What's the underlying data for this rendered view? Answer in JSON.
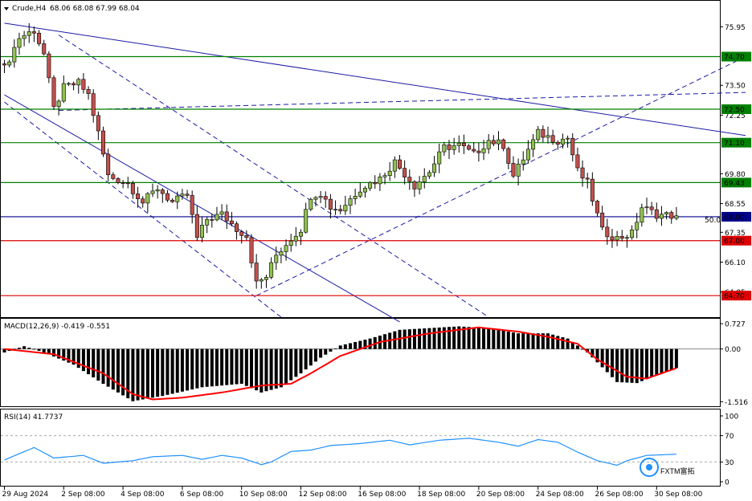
{
  "chart_data": [
    {
      "type": "candlestick",
      "header": {
        "symbol_timeframe": "Crude,H4",
        "ohlc": "68.06 68.08 67.99 68.04"
      },
      "ylim": [
        63.9,
        76.8
      ],
      "y_ticks": [
        "75.95",
        "73.50",
        "72.25",
        "69.80",
        "68.55",
        "67.35",
        "66.10",
        "64.85"
      ],
      "x_tick_labels": [
        "29 Aug 2024",
        "2 Sep 08:00",
        "4 Sep 08:00",
        "6 Sep 08:00",
        "10 Sep 08:00",
        "12 Sep 08:00",
        "16 Sep 08:00",
        "18 Sep 08:00",
        "20 Sep 08:00",
        "24 Sep 08:00",
        "26 Sep 08:00",
        "30 Sep 08:00"
      ],
      "x_tick_index": [
        0,
        12,
        24,
        36,
        48,
        60,
        72,
        84,
        96,
        108,
        120,
        132
      ],
      "candle_count": 137,
      "anchors": [
        {
          "i": 0,
          "p": 74.2
        },
        {
          "i": 3,
          "p": 75.5
        },
        {
          "i": 6,
          "p": 75.8
        },
        {
          "i": 8,
          "p": 74.8
        },
        {
          "i": 10,
          "p": 72.5
        },
        {
          "i": 12,
          "p": 73.4
        },
        {
          "i": 15,
          "p": 73.6
        },
        {
          "i": 17,
          "p": 73.1
        },
        {
          "i": 19,
          "p": 71.5
        },
        {
          "i": 21,
          "p": 69.7
        },
        {
          "i": 25,
          "p": 69.4
        },
        {
          "i": 28,
          "p": 68.6
        },
        {
          "i": 31,
          "p": 69.2
        },
        {
          "i": 34,
          "p": 68.6
        },
        {
          "i": 37,
          "p": 68.9
        },
        {
          "i": 39,
          "p": 67.1
        },
        {
          "i": 41,
          "p": 67.9
        },
        {
          "i": 44,
          "p": 68.1
        },
        {
          "i": 47,
          "p": 67.5
        },
        {
          "i": 49,
          "p": 67.2
        },
        {
          "i": 51,
          "p": 65.2
        },
        {
          "i": 53,
          "p": 65.5
        },
        {
          "i": 55,
          "p": 66.4
        },
        {
          "i": 58,
          "p": 67.1
        },
        {
          "i": 60,
          "p": 67.5
        },
        {
          "i": 62,
          "p": 68.9
        },
        {
          "i": 64,
          "p": 69.0
        },
        {
          "i": 66,
          "p": 68.4
        },
        {
          "i": 68,
          "p": 68.3
        },
        {
          "i": 72,
          "p": 69.2
        },
        {
          "i": 76,
          "p": 69.6
        },
        {
          "i": 79,
          "p": 70.3
        },
        {
          "i": 83,
          "p": 69.3
        },
        {
          "i": 86,
          "p": 69.9
        },
        {
          "i": 89,
          "p": 70.9
        },
        {
          "i": 92,
          "p": 71.0
        },
        {
          "i": 95,
          "p": 70.6
        },
        {
          "i": 98,
          "p": 71.2
        },
        {
          "i": 101,
          "p": 71.0
        },
        {
          "i": 103,
          "p": 69.7
        },
        {
          "i": 106,
          "p": 70.8
        },
        {
          "i": 108,
          "p": 71.5
        },
        {
          "i": 112,
          "p": 71.2
        },
        {
          "i": 114,
          "p": 71.3
        },
        {
          "i": 116,
          "p": 69.9
        },
        {
          "i": 118,
          "p": 69.4
        },
        {
          "i": 121,
          "p": 67.4
        },
        {
          "i": 124,
          "p": 67.1
        },
        {
          "i": 127,
          "p": 67.3
        },
        {
          "i": 129,
          "p": 68.4
        },
        {
          "i": 132,
          "p": 68.1
        },
        {
          "i": 136,
          "p": 68.04
        }
      ],
      "levels": [
        {
          "price": 74.7,
          "label": "74.70",
          "color": "#008000"
        },
        {
          "price": 72.5,
          "label": "72.50",
          "color": "#008000"
        },
        {
          "price": 71.1,
          "label": "71.10",
          "color": "#008000"
        },
        {
          "price": 69.43,
          "label": "69.43",
          "color": "#008000"
        },
        {
          "price": 68.0,
          "label": "68.00",
          "color": "#00008b"
        },
        {
          "price": 67.0,
          "label": "67.00",
          "color": "#dd0000"
        },
        {
          "price": 64.7,
          "label": "64.70",
          "color": "#dd0000"
        }
      ],
      "fib_label": "50.0",
      "trendlines": [
        {
          "i1": 0,
          "p1": 76.1,
          "i2": 150,
          "p2": 71.4,
          "style": "solid"
        },
        {
          "i1": 0,
          "p1": 73.1,
          "i2": 80,
          "p2": 63.6,
          "style": "solid"
        },
        {
          "i1": 11,
          "p1": 75.6,
          "i2": 98,
          "p2": 63.8,
          "style": "dashed"
        },
        {
          "i1": 0,
          "p1": 72.8,
          "i2": 56,
          "p2": 63.8,
          "style": "dashed"
        },
        {
          "i1": 11,
          "p1": 72.45,
          "i2": 150,
          "p2": 73.2,
          "style": "dashed"
        },
        {
          "i1": 51,
          "p1": 64.7,
          "i2": 150,
          "p2": 74.7,
          "style": "dashed"
        }
      ],
      "colors": {
        "bull": "#90c050",
        "bear": "#c0504d",
        "line": "#1a1aa6"
      }
    },
    {
      "type": "histogram",
      "title": "MACD(12,26,9) -0.419 -0.551",
      "ylim": [
        -1.6,
        0.8
      ],
      "y_ticks": [
        "0.727",
        "0.00",
        "-1.516"
      ],
      "macd_anchors": [
        {
          "i": 0,
          "v": -0.1
        },
        {
          "i": 4,
          "v": 0.08
        },
        {
          "i": 8,
          "v": -0.1
        },
        {
          "i": 14,
          "v": -0.45
        },
        {
          "i": 20,
          "v": -1.0
        },
        {
          "i": 26,
          "v": -1.5
        },
        {
          "i": 32,
          "v": -1.35
        },
        {
          "i": 40,
          "v": -1.1
        },
        {
          "i": 48,
          "v": -1.0
        },
        {
          "i": 52,
          "v": -1.25
        },
        {
          "i": 56,
          "v": -1.1
        },
        {
          "i": 60,
          "v": -0.7
        },
        {
          "i": 64,
          "v": -0.25
        },
        {
          "i": 68,
          "v": 0.1
        },
        {
          "i": 74,
          "v": 0.3
        },
        {
          "i": 80,
          "v": 0.55
        },
        {
          "i": 86,
          "v": 0.6
        },
        {
          "i": 92,
          "v": 0.65
        },
        {
          "i": 98,
          "v": 0.6
        },
        {
          "i": 104,
          "v": 0.45
        },
        {
          "i": 110,
          "v": 0.45
        },
        {
          "i": 114,
          "v": 0.3
        },
        {
          "i": 118,
          "v": -0.1
        },
        {
          "i": 124,
          "v": -0.95
        },
        {
          "i": 128,
          "v": -0.98
        },
        {
          "i": 132,
          "v": -0.75
        },
        {
          "i": 136,
          "v": -0.55
        }
      ],
      "signal_anchors": [
        {
          "i": 0,
          "v": 0.0
        },
        {
          "i": 10,
          "v": -0.15
        },
        {
          "i": 20,
          "v": -0.7
        },
        {
          "i": 26,
          "v": -1.3
        },
        {
          "i": 30,
          "v": -1.45
        },
        {
          "i": 36,
          "v": -1.4
        },
        {
          "i": 44,
          "v": -1.25
        },
        {
          "i": 52,
          "v": -1.05
        },
        {
          "i": 58,
          "v": -1.0
        },
        {
          "i": 62,
          "v": -0.7
        },
        {
          "i": 68,
          "v": -0.2
        },
        {
          "i": 76,
          "v": 0.2
        },
        {
          "i": 86,
          "v": 0.45
        },
        {
          "i": 96,
          "v": 0.62
        },
        {
          "i": 104,
          "v": 0.5
        },
        {
          "i": 110,
          "v": 0.35
        },
        {
          "i": 116,
          "v": 0.15
        },
        {
          "i": 120,
          "v": -0.3
        },
        {
          "i": 126,
          "v": -0.8
        },
        {
          "i": 130,
          "v": -0.85
        },
        {
          "i": 136,
          "v": -0.55
        }
      ],
      "colors": {
        "bar": "#000000",
        "signal": "#ff0000"
      }
    },
    {
      "type": "line",
      "title": "RSI(14) 41.7737",
      "ylim": [
        0,
        100
      ],
      "y_ticks": [
        "100",
        "70",
        "30",
        "0"
      ],
      "reference_lines": [
        70,
        30
      ],
      "rsi_anchors": [
        {
          "i": 0,
          "v": 33
        },
        {
          "i": 6,
          "v": 52
        },
        {
          "i": 10,
          "v": 36
        },
        {
          "i": 16,
          "v": 40
        },
        {
          "i": 20,
          "v": 28
        },
        {
          "i": 26,
          "v": 32
        },
        {
          "i": 30,
          "v": 38
        },
        {
          "i": 36,
          "v": 40
        },
        {
          "i": 40,
          "v": 34
        },
        {
          "i": 44,
          "v": 40
        },
        {
          "i": 48,
          "v": 36
        },
        {
          "i": 52,
          "v": 26
        },
        {
          "i": 54,
          "v": 30
        },
        {
          "i": 58,
          "v": 46
        },
        {
          "i": 62,
          "v": 48
        },
        {
          "i": 66,
          "v": 55
        },
        {
          "i": 72,
          "v": 58
        },
        {
          "i": 78,
          "v": 63
        },
        {
          "i": 82,
          "v": 56
        },
        {
          "i": 88,
          "v": 63
        },
        {
          "i": 94,
          "v": 66
        },
        {
          "i": 100,
          "v": 60
        },
        {
          "i": 104,
          "v": 54
        },
        {
          "i": 108,
          "v": 64
        },
        {
          "i": 112,
          "v": 60
        },
        {
          "i": 116,
          "v": 45
        },
        {
          "i": 120,
          "v": 32
        },
        {
          "i": 124,
          "v": 25
        },
        {
          "i": 126,
          "v": 32
        },
        {
          "i": 130,
          "v": 40
        },
        {
          "i": 136,
          "v": 41.77
        }
      ],
      "colors": {
        "line": "#1e90ff"
      }
    }
  ],
  "watermark": {
    "text": "FXTM富拓"
  }
}
